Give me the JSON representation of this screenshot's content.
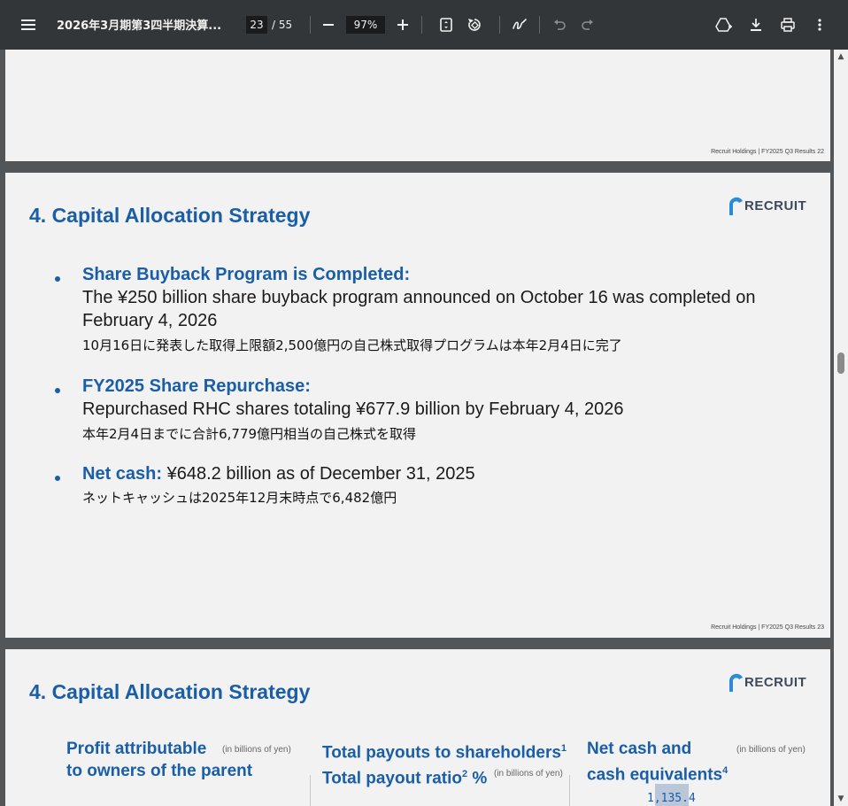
{
  "toolbar": {
    "menu_icon": "hamburger-menu-icon",
    "title": "2026年3月期第3四半期決算...",
    "page_current": "23",
    "page_total": "/ 55",
    "zoom": "97%",
    "icons": [
      "zoom-out-icon",
      "zoom-in-icon",
      "fit-page-icon",
      "rotate-icon",
      "annotate-icon",
      "undo-icon",
      "redo-icon",
      "save-to-drive-icon",
      "download-icon",
      "print-icon",
      "more-options-icon"
    ]
  },
  "pages": {
    "page22": {
      "footer": "Recruit Holdings | FY2025 Q3 Results   22"
    },
    "page23": {
      "title": "4. Capital Allocation Strategy",
      "logo_text": "RECRUIT",
      "bullets": [
        {
          "heading": "Share Buyback Program is Completed:",
          "line1": "The ¥250 billion share buyback program announced on October 16 was completed on",
          "line2": "February 4, 2026",
          "jp": "10月16日に発表した取得上限額2,500億円の自己株式取得プログラムは本年2月4日に完了"
        },
        {
          "heading": "FY2025 Share Repurchase:",
          "line1": "Repurchased RHC shares totaling ¥677.9 billion by February 4, 2026",
          "jp": "本年2月4日までに合計6,779億円相当の自己株式を取得"
        },
        {
          "heading": "Net cash:",
          "line1": "¥648.2 billion as of December 31, 2025",
          "jp": "ネットキャッシュは2025年12月末時点で6,482億円"
        }
      ],
      "footer": "Recruit Holdings | FY2025 Q3 Results   23"
    },
    "page24": {
      "title": "4. Capital Allocation Strategy",
      "logo_text": "RECRUIT",
      "columns": [
        {
          "line1": "Profit attributable",
          "line2": "to owners of the parent",
          "unit": "(in billions of yen)",
          "sup1": "",
          "sup2": ""
        },
        {
          "line1": "Total payouts to shareholders",
          "sup1": "1",
          "line2": "Total payout ratio",
          "sup2": "2",
          "line2_suffix": " %",
          "unit": "(in billions of yen)"
        },
        {
          "line1": "Net cash and",
          "line2": "cash equivalents",
          "sup2": "4",
          "unit": "(in billions of yen)"
        }
      ],
      "visible_value": "1,135.4"
    }
  },
  "colors": {
    "accent": "#1a5ea8",
    "toolbar": "#323639",
    "viewer_bg": "#525659",
    "page_bg": "#f2f2f2"
  }
}
